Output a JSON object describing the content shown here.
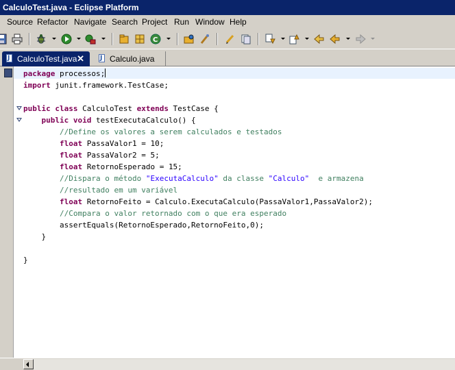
{
  "window": {
    "title": "CalculoTest.java - Eclipse Platform"
  },
  "menu": [
    "Source",
    "Refactor",
    "Navigate",
    "Search",
    "Project",
    "Run",
    "Window",
    "Help"
  ],
  "toolbar_icons": [
    "save-icon",
    "print-icon",
    "debug-icon",
    "run-icon",
    "external-tools-icon",
    "new-package-icon",
    "new-class-icon",
    "new-wizard-icon",
    "open-type-icon",
    "search-icon",
    "edit-icon",
    "toggle-mark-icon",
    "next-annotation-icon",
    "prev-annotation-icon",
    "back-icon",
    "forward-icon"
  ],
  "tabs": [
    {
      "label": "CalculoTest.java",
      "close": "✕"
    },
    {
      "label": "Calculo.java"
    }
  ],
  "code": {
    "l1": {
      "kw": "package",
      "rest": " processos;"
    },
    "l2": {
      "kw": "import",
      "rest": " junit.framework.TestCase;"
    },
    "l4": {
      "kw1": "public class",
      "mid": " CalculoTest ",
      "kw2": "extends",
      "rest": " TestCase {"
    },
    "l5": {
      "kw1": "public void",
      "rest": " testExecutaCalculo() {"
    },
    "l6": "//Define os valores a serem calculados e testados",
    "l7": {
      "kw": "float",
      "rest": " PassaValor1 = 10;"
    },
    "l8": {
      "kw": "float",
      "rest": " PassaValor2 = 5;"
    },
    "l9": {
      "kw": "float",
      "rest": " RetornoEsperado = 15;"
    },
    "l10": {
      "c1": "//Dispara o método ",
      "s1": "\"ExecutaCalculo\"",
      "c2": " da classe ",
      "s2": "\"Calculo\"",
      "c3": "  e armazena"
    },
    "l11": "//resultado em um variável",
    "l12": {
      "kw": "float",
      "rest": " RetornoFeito = Calculo.ExecutaCalculo(PassaValor1,PassaValor2);"
    },
    "l13": "//Compara o valor retornado com o que era esperado",
    "l14": "assertEquals(RetornoEsperado,RetornoFeito,0);",
    "l15": "}",
    "l17": "}"
  },
  "colors": {
    "keyword": "#7f0055",
    "comment": "#3f7f5f",
    "string": "#2a00ff",
    "title_bar": "#0a246a",
    "chrome": "#d4d0c8"
  }
}
